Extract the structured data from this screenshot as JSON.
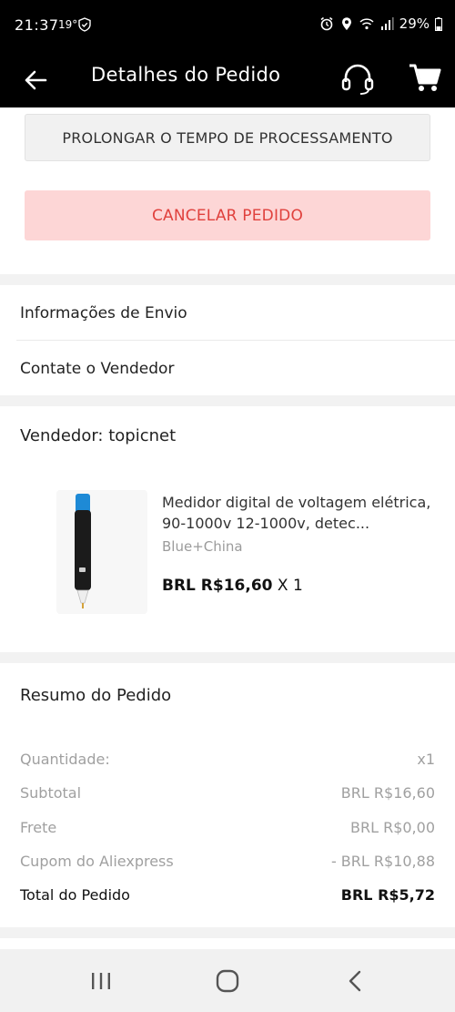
{
  "status": {
    "time": "21:37",
    "temp": "19°",
    "battery": "29%"
  },
  "header": {
    "title": "Detalhes do Pedido"
  },
  "actions": {
    "extend_label": "PROLONGAR O TEMPO DE PROCESSAMENTO",
    "cancel_label": "CANCELAR PEDIDO"
  },
  "links": {
    "shipping_info": "Informações de Envio",
    "contact_seller": "Contate o Vendedor"
  },
  "order": {
    "seller": "Vendedor: topicnet",
    "product": {
      "name": "Medidor digital de voltagem elétrica, 90-1000v 12-1000v, detec...",
      "variant": "Blue+China",
      "price": "BRL R$16,60",
      "quantity": " X 1"
    }
  },
  "summary": {
    "title": "Resumo do Pedido",
    "rows": [
      {
        "label": "Quantidade:",
        "value": "x1"
      },
      {
        "label": "Subtotal",
        "value": "BRL R$16,60"
      },
      {
        "label": "Frete",
        "value": "BRL R$0,00"
      },
      {
        "label": "Cupom do Aliexpress",
        "value": "- BRL R$10,88"
      },
      {
        "label": "Total do Pedido",
        "value": "BRL R$5,72"
      }
    ]
  },
  "colors": {
    "cancel_text": "#e0413d",
    "cancel_bg": "#fdd6d6",
    "appbar": "#000000"
  }
}
